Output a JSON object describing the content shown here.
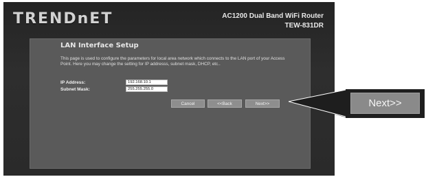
{
  "header": {
    "brand": "TRENDnET",
    "model_line1": "AC1200 Dual Band WiFi Router",
    "model_line2": "TEW-831DR"
  },
  "panel": {
    "title": "LAN Interface Setup",
    "description": "This page is used to configure the parameters for local area network which connects to the LAN port of your Access Point. Here you may change the setting for IP addresss, subnet mask, DHCP, etc..",
    "ip_label": "IP Address:",
    "ip_value": "192.168.10.1",
    "mask_label": "Subnet Mask:",
    "mask_value": "255.255.255.0"
  },
  "buttons": {
    "cancel": "Cancel",
    "back": "<<Back",
    "next": "Next>>"
  },
  "callout": {
    "label": "Next>>"
  }
}
